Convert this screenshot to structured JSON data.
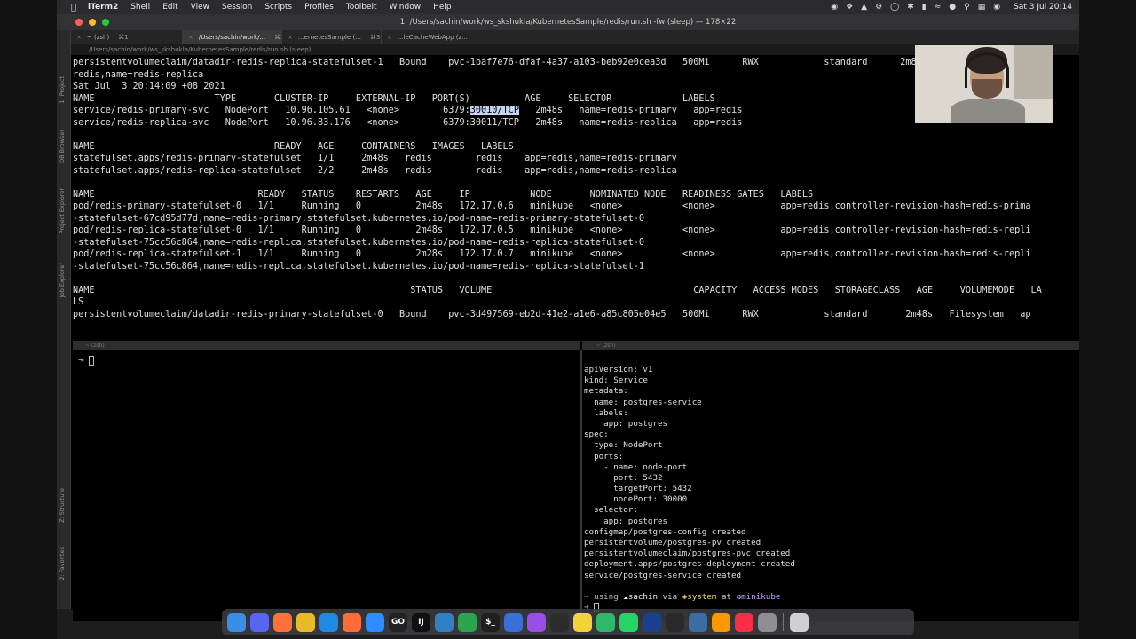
{
  "menubar": {
    "app_name": "iTerm2",
    "items": [
      "Shell",
      "Edit",
      "View",
      "Session",
      "Scripts",
      "Profiles",
      "Toolbelt",
      "Window",
      "Help"
    ],
    "clock": "Sat 3 Jul  20:14"
  },
  "window": {
    "title": "1. /Users/sachin/work/ws_skshukla/KubernetesSample/redis/run.sh -fw (sleep) — 178×22"
  },
  "tabs": [
    {
      "label": "~ (zsh)",
      "shortcut": "⌘1"
    },
    {
      "label": "/Users/sachin/work/...",
      "shortcut": "⌘2"
    },
    {
      "label": "...ernetesSample (...",
      "shortcut": "⌘3"
    },
    {
      "label": "...leCacheWebApp (z...",
      "shortcut": "⌘4"
    }
  ],
  "path_bar": "/Users/sachin/work/ws_skshukla/KubernetesSample/redis/run.sh (sleep)",
  "side_panels": [
    "1: Project",
    "DB Browser",
    "Project Explorer",
    "Job Explorer",
    "Z: Structure",
    "2: Favorites"
  ],
  "top_terminal": {
    "lines": [
      "persistentvolumeclaim/datadir-redis-replica-statefulset-1   Bound    pvc-1baf7e76-dfaf-4a37-a103-beb92e0cea3d   500Mi      RWX            standard      2m8s    Filesystem  ap",
      "redis,name=redis-replica",
      "Sat Jul  3 20:14:09 +08 2021",
      "NAME                      TYPE       CLUSTER-IP     EXTERNAL-IP   PORT(S)          AGE     SELECTOR             LABELS",
      "service/redis-primary-svc   NodePort   10.96.105.61   <none>        6379:",
      "service/redis-replica-svc   NodePort   10.96.83.176   <none>        6379:30011/TCP   2m48s   name=redis-replica   app=redis",
      "",
      "NAME                                 READY   AGE     CONTAINERS   IMAGES   LABELS",
      "statefulset.apps/redis-primary-statefulset   1/1     2m48s   redis        redis    app=redis,name=redis-primary",
      "statefulset.apps/redis-replica-statefulset   2/2     2m48s   redis        redis    app=redis,name=redis-replica",
      "",
      "NAME                              READY   STATUS    RESTARTS   AGE     IP           NODE       NOMINATED NODE   READINESS GATES   LABELS",
      "pod/redis-primary-statefulset-0   1/1     Running   0          2m48s   172.17.0.6   minikube   <none>           <none>            app=redis,controller-revision-hash=redis-prima",
      "-statefulset-67cd95d77d,name=redis-primary,statefulset.kubernetes.io/pod-name=redis-primary-statefulset-0",
      "pod/redis-replica-statefulset-0   1/1     Running   0          2m48s   172.17.0.5   minikube   <none>           <none>            app=redis,controller-revision-hash=redis-repli",
      "-statefulset-75cc56c864,name=redis-replica,statefulset.kubernetes.io/pod-name=redis-replica-statefulset-0",
      "pod/redis-replica-statefulset-1   1/1     Running   0          2m28s   172.17.0.7   minikube   <none>           <none>            app=redis,controller-revision-hash=redis-repli",
      "-statefulset-75cc56c864,name=redis-replica,statefulset.kubernetes.io/pod-name=redis-replica-statefulset-1",
      "",
      "NAME                                                          STATUS   VOLUME                                     CAPACITY   ACCESS MODES   STORAGECLASS   AGE     VOLUMEMODE   LA",
      "LS",
      "persistentvolumeclaim/datadir-redis-primary-statefulset-0   Bound    pvc-3d497569-eb2d-41e2-a1e6-a85c805e04e5   500Mi      RWX            standard       2m48s   Filesystem   ap"
    ],
    "highlight": "30010/TCP",
    "after_highlight": "   2m48s   name=redis-primary   app=redis"
  },
  "left_pane": {
    "title": "~ (zsh)",
    "prompt": "➜"
  },
  "right_pane": {
    "title": "~ (zsh)",
    "lines": [
      "apiVersion: v1",
      "kind: Service",
      "metadata:",
      "  name: postgres-service",
      "  labels:",
      "    app: postgres",
      "spec:",
      "  type: NodePort",
      "  ports:",
      "    - name: node-port",
      "      port: 5432",
      "      targetPort: 5432",
      "      nodePort: 30000",
      "  selector:",
      "    app: postgres",
      "configmap/postgres-config created",
      "persistentvolume/postgres-pv created",
      "persistentvolumeclaim/postgres-pvc created",
      "deployment.apps/postgres-deployment created",
      "service/postgres-service created"
    ],
    "prompt_line": {
      "prefix": "~ using ",
      "user": "sachin",
      "via": " via ",
      "env": "system",
      "at": " at ",
      "context": "minikube"
    },
    "prompt": "➜"
  },
  "dock_apps": [
    {
      "name": "finder",
      "label": "",
      "color": "#3a8ee6"
    },
    {
      "name": "discord",
      "label": "",
      "color": "#5865f2"
    },
    {
      "name": "firefox",
      "label": "",
      "color": "#ff7139"
    },
    {
      "name": "chrome",
      "label": "",
      "color": "#e8ba2a"
    },
    {
      "name": "safari",
      "label": "",
      "color": "#1e88e5"
    },
    {
      "name": "postman",
      "label": "",
      "color": "#ff6c37"
    },
    {
      "name": "zoom",
      "label": "",
      "color": "#2d8cff"
    },
    {
      "name": "goland",
      "label": "GO",
      "color": "#222222"
    },
    {
      "name": "intellij",
      "label": "IJ",
      "color": "#111111"
    },
    {
      "name": "vscode",
      "label": "",
      "color": "#2f80c4"
    },
    {
      "name": "circle-app",
      "label": "",
      "color": "#2ea44f"
    },
    {
      "name": "iterm",
      "label": "$_",
      "color": "#1f1f1f"
    },
    {
      "name": "app-blue",
      "label": "",
      "color": "#3b6fd8"
    },
    {
      "name": "podcasts",
      "label": "",
      "color": "#9b4de6"
    },
    {
      "name": "quicktime",
      "label": "",
      "color": "#2c2c2c"
    },
    {
      "name": "notes",
      "label": "",
      "color": "#f4d23c"
    },
    {
      "name": "app-green",
      "label": "",
      "color": "#2fb86a"
    },
    {
      "name": "whatsapp",
      "label": "",
      "color": "#25d366"
    },
    {
      "name": "virtualbox",
      "label": "",
      "color": "#1b3f8f"
    },
    {
      "name": "app-dark",
      "label": "",
      "color": "#2a2a2a"
    },
    {
      "name": "app-tool",
      "label": "",
      "color": "#3a6ea5"
    },
    {
      "name": "sublime",
      "label": "",
      "color": "#ff9800"
    },
    {
      "name": "music",
      "label": "",
      "color": "#fa2d48"
    },
    {
      "name": "settings",
      "label": "",
      "color": "#8e8e93"
    },
    {
      "name": "trash",
      "label": "",
      "color": "#d0d0d0"
    }
  ]
}
